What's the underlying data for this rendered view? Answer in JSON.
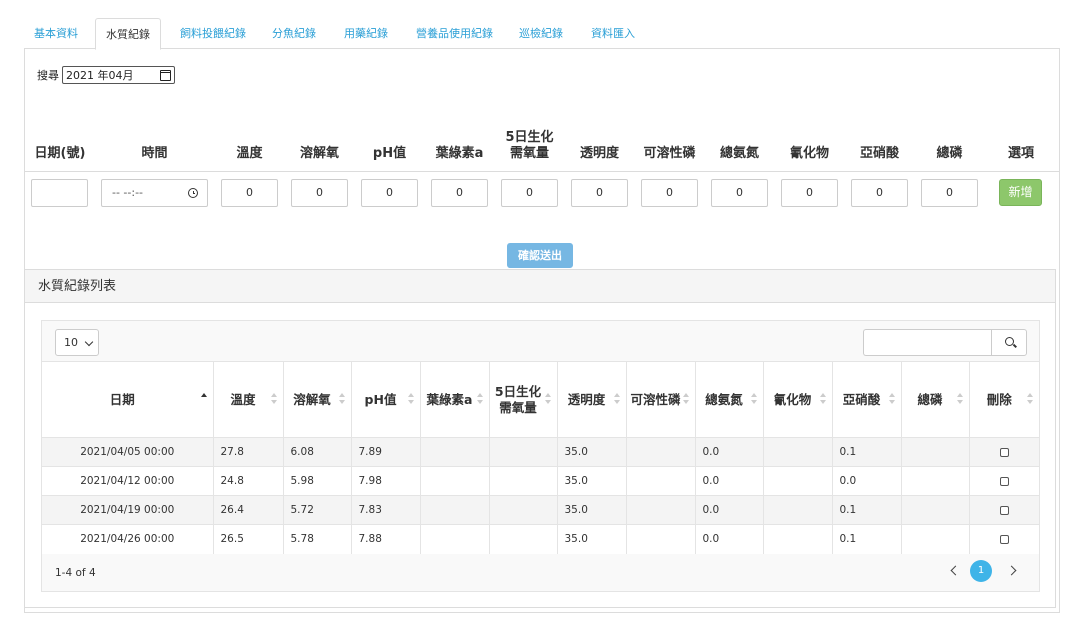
{
  "tabs": [
    {
      "label": "基本資料",
      "active": false
    },
    {
      "label": "水質紀錄",
      "active": true
    },
    {
      "label": "飼料投餵紀錄",
      "active": false
    },
    {
      "label": "分魚紀錄",
      "active": false
    },
    {
      "label": "用藥紀錄",
      "active": false
    },
    {
      "label": "營養品使用紀錄",
      "active": false
    },
    {
      "label": "巡檢紀錄",
      "active": false
    },
    {
      "label": "資料匯入",
      "active": false
    }
  ],
  "search": {
    "label": "搜尋",
    "month_value": "2021 年04月"
  },
  "entry_form": {
    "columns": [
      "日期(號)",
      "時間",
      "溫度",
      "溶解氧",
      "pH值",
      "葉綠素a",
      "5日生化需氧量",
      "透明度",
      "可溶性磷",
      "總氨氮",
      "氰化物",
      "亞硝酸",
      "總磷",
      "選項"
    ],
    "date_value": "",
    "time_placeholder": "-- --:--",
    "values": [
      "0",
      "0",
      "0",
      "0",
      "0",
      "0",
      "0",
      "0",
      "0",
      "0",
      "0"
    ],
    "add_label": "新增"
  },
  "submit_label": "確認送出",
  "list": {
    "title": "水質紀錄列表",
    "page_length": "10",
    "columns": [
      "日期",
      "溫度",
      "溶解氧",
      "pH值",
      "葉綠素a",
      "5日生化需氧量",
      "透明度",
      "可溶性磷",
      "總氨氮",
      "氰化物",
      "亞硝酸",
      "總磷",
      "刪除"
    ],
    "rows": [
      [
        "2021/04/05 00:00",
        "27.8",
        "6.08",
        "7.89",
        "",
        "",
        "35.0",
        "",
        "0.0",
        "",
        "0.1",
        ""
      ],
      [
        "2021/04/12 00:00",
        "24.8",
        "5.98",
        "7.98",
        "",
        "",
        "35.0",
        "",
        "0.0",
        "",
        "0.0",
        ""
      ],
      [
        "2021/04/19 00:00",
        "26.4",
        "5.72",
        "7.83",
        "",
        "",
        "35.0",
        "",
        "0.0",
        "",
        "0.1",
        ""
      ],
      [
        "2021/04/26 00:00",
        "26.5",
        "5.78",
        "7.88",
        "",
        "",
        "35.0",
        "",
        "0.0",
        "",
        "0.1",
        ""
      ]
    ],
    "info": "1-4 of 4",
    "current_page": "1"
  }
}
